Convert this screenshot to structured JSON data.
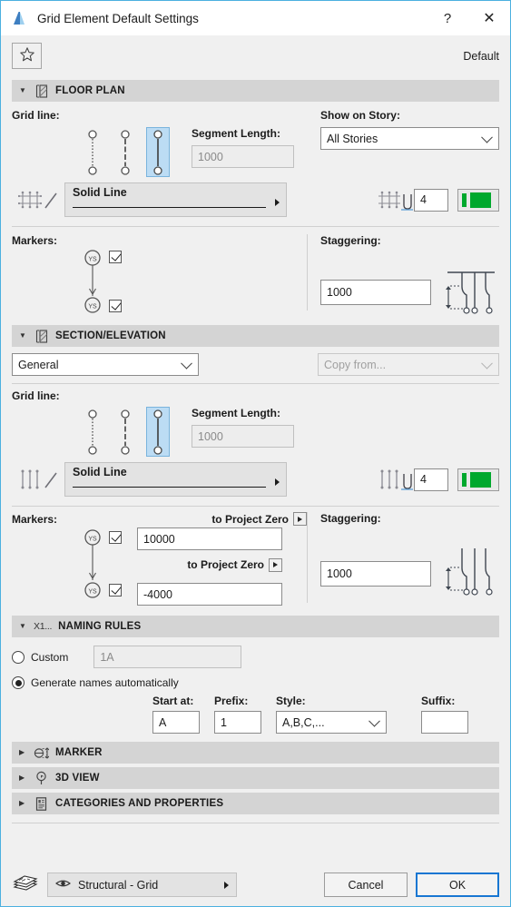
{
  "window": {
    "title": "Grid Element Default Settings",
    "help_label": "?",
    "close_label": "✕",
    "app_icon": "archicad-icon"
  },
  "favorites": {
    "star_icon": "favorites-star-icon",
    "default_label": "Default"
  },
  "floor_plan": {
    "header": "FLOOR PLAN",
    "grid_line_label": "Grid line:",
    "style_options": [
      "dotted-grid-line",
      "dashed-grid-line",
      "solid-grid-line"
    ],
    "selected_style_index": 2,
    "segment_length_label": "Segment Length:",
    "segment_length_value": "1000",
    "line_type_icon": "grid-dots-linetype-icon",
    "line_type_value": "Solid Line",
    "show_on_story_label": "Show on Story:",
    "show_on_story_value": "All Stories",
    "pen_icon": "grid-dots-pen-icon",
    "pen_value": "4",
    "pen_color": "#00a82d",
    "markers_label": "Markers:",
    "marker_top_checked": true,
    "marker_bottom_checked": true,
    "marker_glyph": "ys-marker-icon",
    "staggering_label": "Staggering:",
    "staggering_value": "1000",
    "staggering_icon": "staggering-diagram-icon"
  },
  "section_elevation": {
    "header": "SECTION/ELEVATION",
    "scope_value": "General",
    "copy_from_placeholder": "Copy from...",
    "grid_line_label": "Grid line:",
    "style_options": [
      "dotted-grid-line",
      "dashed-grid-line",
      "solid-grid-line"
    ],
    "selected_style_index": 2,
    "segment_length_label": "Segment Length:",
    "segment_length_value": "1000",
    "line_type_icon": "grid-bars-linetype-icon",
    "line_type_value": "Solid Line",
    "pen_icon": "grid-bars-pen-icon",
    "pen_value": "4",
    "pen_color": "#00a82d",
    "markers_label": "Markers:",
    "top_anchor_label": "to Project Zero",
    "top_value": "10000",
    "bottom_anchor_label": "to Project Zero",
    "bottom_value": "-4000",
    "marker_top_checked": true,
    "marker_bottom_checked": true,
    "staggering_label": "Staggering:",
    "staggering_value": "1000",
    "staggering_icon": "staggering-diagram-icon"
  },
  "naming_rules": {
    "header": "NAMING RULES",
    "header_prefix": "X1...",
    "custom_label": "Custom",
    "custom_selected": false,
    "custom_value": "1A",
    "auto_label": "Generate names automatically",
    "auto_selected": true,
    "start_at_label": "Start at:",
    "start_at_value": "A",
    "prefix_label": "Prefix:",
    "prefix_value": "1",
    "style_label": "Style:",
    "style_value": "A,B,C,...",
    "suffix_label": "Suffix:",
    "suffix_value": ""
  },
  "collapsed_sections": [
    {
      "label": "MARKER",
      "icon": "marker-icon"
    },
    {
      "label": "3D VIEW",
      "icon": "3d-view-icon"
    },
    {
      "label": "CATEGORIES AND PROPERTIES",
      "icon": "categories-properties-icon"
    }
  ],
  "footer": {
    "layers_icon": "layers-stack-icon",
    "eye_icon": "eye-visibility-icon",
    "layer_value": "Structural - Grid",
    "cancel_label": "Cancel",
    "ok_label": "OK"
  }
}
